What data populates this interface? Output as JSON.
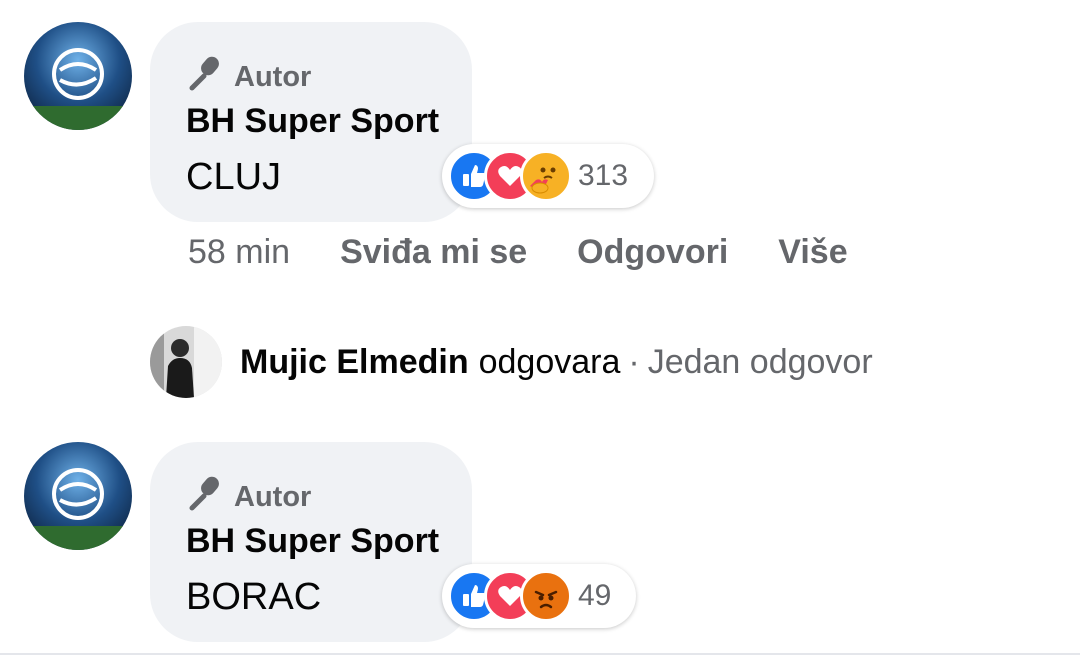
{
  "comments": [
    {
      "badge_label": "Autor",
      "author": "BH Super Sport",
      "text": "CLUJ",
      "reactions": [
        "like",
        "love",
        "care"
      ],
      "reaction_count": "313"
    },
    {
      "badge_label": "Autor",
      "author": "BH Super Sport",
      "text": "BORAC",
      "reactions": [
        "like",
        "love",
        "angry"
      ],
      "reaction_count": "49"
    }
  ],
  "actions": {
    "time": "58 min",
    "like_label": "Sviđa mi se",
    "reply_label": "Odgovori",
    "more_label": "Više"
  },
  "reply_summary": {
    "name": "Mujic Elmedin",
    "verb": "odgovara",
    "separator": "·",
    "count_text": "Jedan odgovor"
  },
  "colors": {
    "bubble": "#f0f2f5",
    "secondary_text": "#65676b",
    "like_blue": "#1877f2",
    "love_red": "#f33e58",
    "care_yellow": "#f7b125",
    "angry_orange": "#e9710f"
  },
  "icons": [
    "microphone-icon",
    "like-reaction-icon",
    "love-reaction-icon",
    "care-reaction-icon",
    "angry-reaction-icon"
  ]
}
